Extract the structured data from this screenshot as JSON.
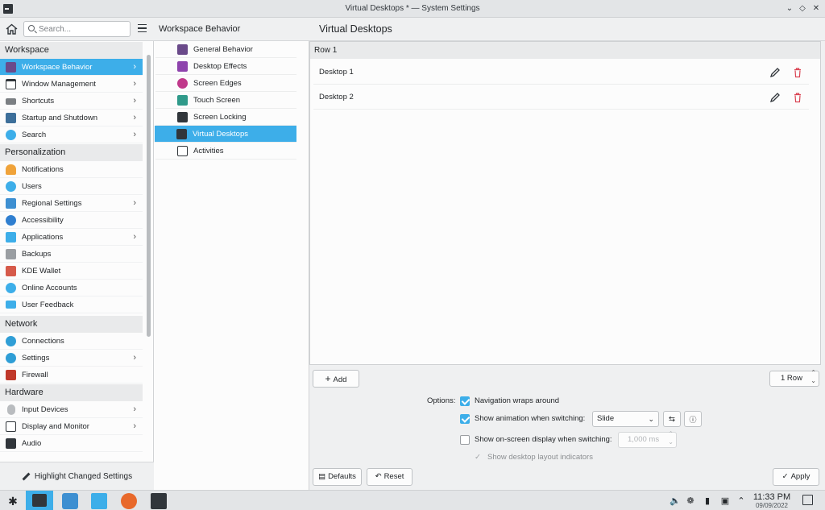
{
  "window": {
    "title": "Virtual Desktops * — System Settings"
  },
  "sidebar": {
    "search_placeholder": "Search...",
    "categories": {
      "workspace": "Workspace",
      "personalization": "Personalization",
      "network": "Network",
      "hardware": "Hardware"
    },
    "workspace_items": [
      {
        "label": "Workspace Behavior",
        "selected": true,
        "has_children": true
      },
      {
        "label": "Window Management",
        "has_children": true
      },
      {
        "label": "Shortcuts",
        "has_children": true
      },
      {
        "label": "Startup and Shutdown",
        "has_children": true
      },
      {
        "label": "Search",
        "has_children": true
      }
    ],
    "personalization_items": [
      {
        "label": "Notifications"
      },
      {
        "label": "Users"
      },
      {
        "label": "Regional Settings",
        "has_children": true
      },
      {
        "label": "Accessibility"
      },
      {
        "label": "Applications",
        "has_children": true
      },
      {
        "label": "Backups"
      },
      {
        "label": "KDE Wallet"
      },
      {
        "label": "Online Accounts"
      },
      {
        "label": "User Feedback"
      }
    ],
    "network_items": [
      {
        "label": "Connections"
      },
      {
        "label": "Settings",
        "has_children": true
      },
      {
        "label": "Firewall"
      }
    ],
    "hardware_items": [
      {
        "label": "Input Devices",
        "has_children": true
      },
      {
        "label": "Display and Monitor",
        "has_children": true
      },
      {
        "label": "Audio"
      }
    ],
    "highlight_button": "Highlight Changed Settings"
  },
  "middle": {
    "title": "Workspace Behavior",
    "items": [
      {
        "label": "General Behavior"
      },
      {
        "label": "Desktop Effects"
      },
      {
        "label": "Screen Edges"
      },
      {
        "label": "Touch Screen"
      },
      {
        "label": "Screen Locking"
      },
      {
        "label": "Virtual Desktops",
        "selected": true
      },
      {
        "label": "Activities"
      }
    ]
  },
  "main": {
    "title": "Virtual Desktops",
    "row_header": "Row 1",
    "desktops": [
      {
        "name": "Desktop 1"
      },
      {
        "name": "Desktop 2"
      }
    ],
    "add_button": "Add",
    "rows_spin": "1 Row",
    "options_label": "Options:",
    "navigation_wraps": {
      "label": "Navigation wraps around",
      "checked": true
    },
    "show_animation": {
      "label": "Show animation when switching:",
      "checked": true,
      "value": "Slide"
    },
    "show_osd": {
      "label": "Show on-screen display when switching:",
      "checked": false,
      "value": "1,000 ms"
    },
    "show_layout": {
      "label": "Show desktop layout indicators",
      "checked": true,
      "disabled": true
    },
    "defaults_button": "Defaults",
    "reset_button": "Reset",
    "apply_button": "Apply"
  },
  "taskbar": {
    "time": "11:33 PM",
    "date": "09/09/2022"
  },
  "colors": {
    "accent": "#3daee9",
    "delete": "#da4453"
  }
}
